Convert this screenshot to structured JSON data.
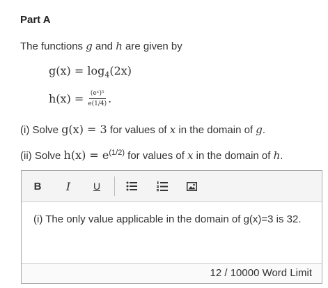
{
  "part_title": "Part A",
  "intro": {
    "pre": "The functions ",
    "g": "g",
    "and": " and ",
    "h": "h",
    "post": " are given by"
  },
  "equations": {
    "g_lhs": "g(x) = log",
    "g_sub": "4",
    "g_rhs": "(2x)",
    "h_lhs": "h(x) =",
    "h_num": "(eˣ)⁵",
    "h_den": "e(1/4)",
    "h_end": "."
  },
  "questions": {
    "q1_pre": "(i) Solve ",
    "q1_math": "g(x) = 3",
    "q1_mid": " for values of ",
    "q1_x": "x",
    "q1_mid2": " in the domain of ",
    "q1_g": "g",
    "q1_end": ".",
    "q2_pre": "(ii) Solve ",
    "q2_math": "h(x) = e",
    "q2_sup": "(1/2)",
    "q2_mid": " for values of ",
    "q2_x": "x",
    "q2_mid2": " in the domain of ",
    "q2_h": "h",
    "q2_end": "."
  },
  "toolbar": {
    "bold": "B",
    "italic": "I",
    "underline": "U",
    "icons": [
      "bold-icon",
      "italic-icon",
      "underline-icon",
      "bulleted-list-icon",
      "numbered-list-icon",
      "image-icon"
    ]
  },
  "editor": {
    "content": "(i) The only value applicable in the domain of g(x)=3 is 32.",
    "word_count": "12 / 10000 Word Limit"
  }
}
